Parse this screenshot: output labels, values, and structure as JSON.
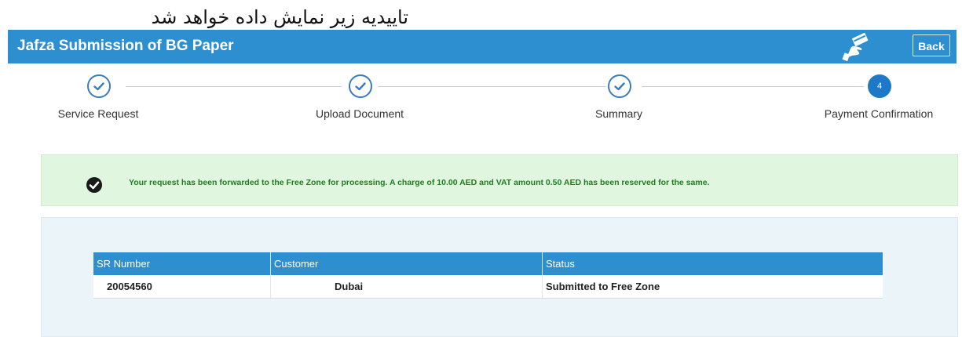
{
  "caption": "تاییدیه زیر نمایش داده خواهد شد",
  "header": {
    "title": "Jafza Submission of BG Paper",
    "back_label": "Back",
    "icon": "hand-card-icon"
  },
  "steps": [
    {
      "label": "Service Request",
      "state": "done"
    },
    {
      "label": "Upload Document",
      "state": "done"
    },
    {
      "label": "Summary",
      "state": "done"
    },
    {
      "label": "Payment Confirmation",
      "state": "active",
      "number": "4"
    }
  ],
  "alert": {
    "icon": "check-circle-icon",
    "message": "Your request has been forwarded to the Free Zone for processing. A charge of 10.00 AED and VAT amount 0.50 AED has been reserved for the same."
  },
  "table": {
    "columns": [
      "SR Number",
      "Customer",
      "Status"
    ],
    "rows": [
      [
        "20054560",
        "Dubai",
        "Submitted to Free Zone"
      ]
    ]
  },
  "colors": {
    "brand": "#2e8fd0",
    "success_bg": "#e1f6de",
    "success_text": "#1e7d22"
  }
}
